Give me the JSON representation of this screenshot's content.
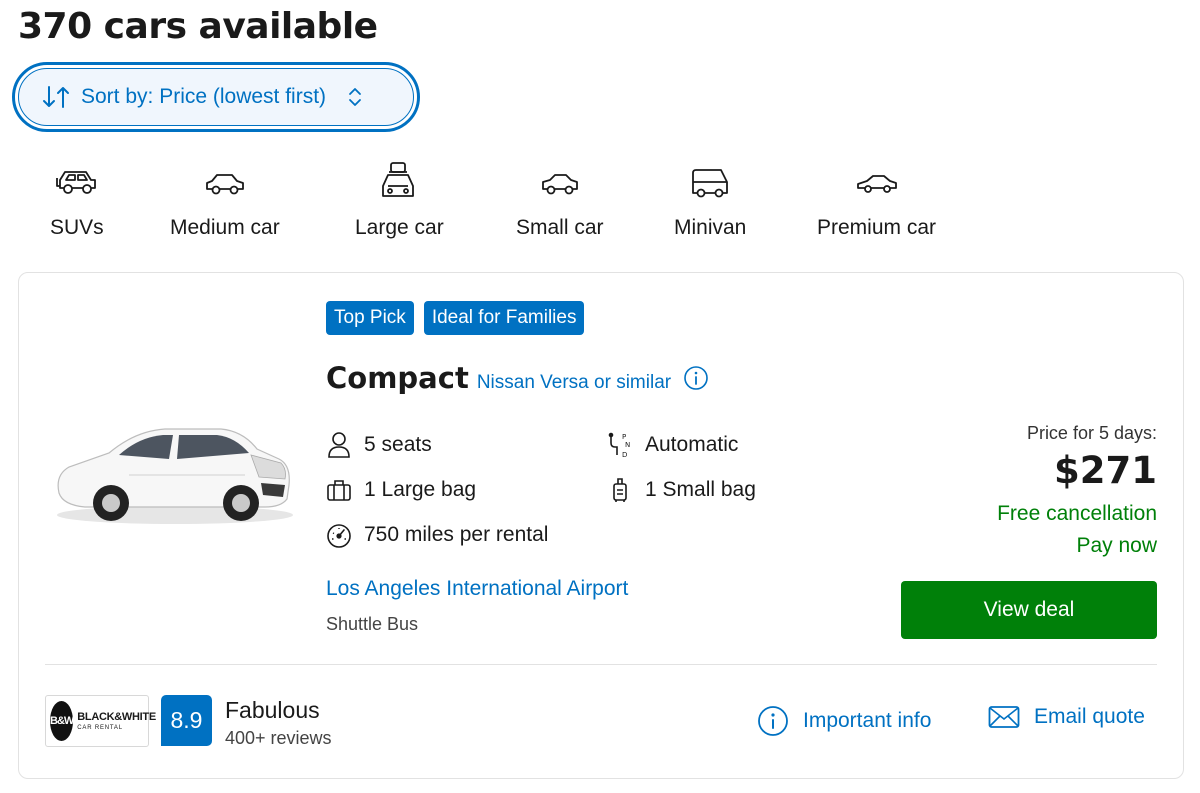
{
  "results": {
    "title": "370 cars available"
  },
  "sort": {
    "label": "Sort by: Price (lowest first)"
  },
  "categories": [
    {
      "label": "SUVs",
      "icon": "suv-icon"
    },
    {
      "label": "Medium car",
      "icon": "medium-car-icon"
    },
    {
      "label": "Large car",
      "icon": "large-car-icon"
    },
    {
      "label": "Small car",
      "icon": "small-car-icon"
    },
    {
      "label": "Minivan",
      "icon": "minivan-icon"
    },
    {
      "label": "Premium car",
      "icon": "premium-car-icon"
    }
  ],
  "listing": {
    "badges": [
      "Top Pick",
      "Ideal for Families"
    ],
    "car_class": "Compact",
    "car_model": "Nissan Versa or similar",
    "specs": {
      "seats": "5 seats",
      "transmission": "Automatic",
      "large_bag": "1 Large bag",
      "small_bag": "1 Small bag",
      "mileage": "750 miles per rental"
    },
    "location": {
      "name": "Los Angeles International Airport",
      "type": "Shuttle Bus"
    },
    "price": {
      "label": "Price for 5 days:",
      "amount": "$271",
      "free_cancellation": "Free cancellation",
      "pay_now": "Pay now",
      "cta": "View deal"
    },
    "supplier": {
      "logo_mark": "B&W",
      "logo_name": "BLACK&WHITE",
      "logo_sub": "CAR RENTAL",
      "score": "8.9",
      "rating_word": "Fabulous",
      "reviews": "400+ reviews"
    },
    "actions": {
      "important_info": "Important info",
      "email_quote": "Email quote"
    }
  },
  "colors": {
    "accent": "#0071c2",
    "success": "#008009",
    "badge_bg": "#0071c2",
    "text": "#1a1a1a"
  }
}
